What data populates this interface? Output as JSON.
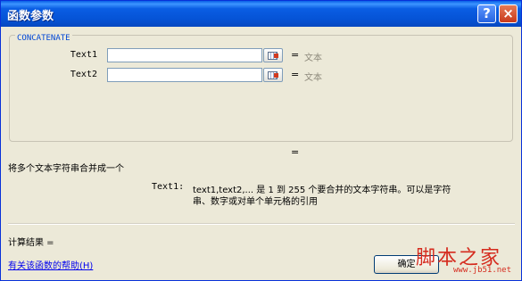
{
  "window": {
    "title": "函数参数",
    "help_glyph": "?",
    "close_glyph": "×"
  },
  "function_group": {
    "legend": "CONCATENATE",
    "args": [
      {
        "label": "Text1",
        "value": "",
        "equals": "=",
        "result": "文本"
      },
      {
        "label": "Text2",
        "value": "",
        "equals": "=",
        "result": "文本"
      }
    ],
    "result_equals": "="
  },
  "description": "将多个文本字符串合并成一个",
  "arg_help": {
    "name": "Text1:",
    "line1": "text1,text2,... 是 1 到 255 个要合并的文本字符串。可以是字符",
    "line2": "串、数字或对单个单元格的引用"
  },
  "calc_result": {
    "label": "计算结果 ="
  },
  "help_link": "有关该函数的帮助(H)",
  "ok_button": "确定",
  "watermark": {
    "chinese": "脚本之家",
    "url": "www.jb51.net",
    "color": "#d52b1e"
  },
  "icons": [
    "help-icon",
    "close-icon",
    "collapse-dialog-icon"
  ]
}
